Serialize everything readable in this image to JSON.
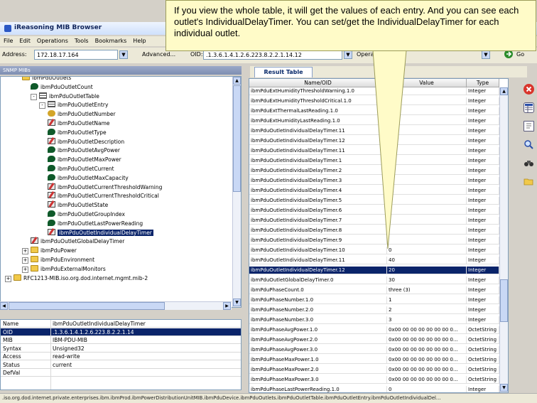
{
  "app": {
    "title": "iReasoning MIB Browser"
  },
  "menu": [
    "File",
    "Edit",
    "Operations",
    "Tools",
    "Bookmarks",
    "Help"
  ],
  "address_bar": {
    "address_label": "Address:",
    "address_value": "172.18.17.164",
    "advanced_label": "Advanced...",
    "oid_label": "OID:",
    "oid_value": ".1.3.6.1.4.1.2.6.223.8.2.2.1.14.12",
    "operations_label": "Opera",
    "go_label": "Go"
  },
  "left_panel": {
    "title": "SNMP MIBs"
  },
  "tree": [
    {
      "label": "ibmPduOutlets",
      "icon": "folder-icon",
      "indent": 2,
      "expander": ""
    },
    {
      "label": "ibmPduOutletCount",
      "icon": "leaf-icon",
      "indent": 3,
      "expander": ""
    },
    {
      "label": "ibmPduOutletTable",
      "icon": "table-icon",
      "indent": 3,
      "expander": "-"
    },
    {
      "label": "ibmPduOutletEntry",
      "icon": "table-icon",
      "indent": 4,
      "expander": "-"
    },
    {
      "label": "ibmPduOutletNumber",
      "icon": "key-icon",
      "indent": 5,
      "expander": ""
    },
    {
      "label": "ibmPduOutletName",
      "icon": "write-icon",
      "indent": 5,
      "expander": ""
    },
    {
      "label": "ibmPduOutletType",
      "icon": "leaf-icon",
      "indent": 5,
      "expander": ""
    },
    {
      "label": "ibmPduOutletDescription",
      "icon": "write-icon",
      "indent": 5,
      "expander": ""
    },
    {
      "label": "ibmPduOutletAvgPower",
      "icon": "leaf-icon",
      "indent": 5,
      "expander": ""
    },
    {
      "label": "ibmPduOutletMaxPower",
      "icon": "leaf-icon",
      "indent": 5,
      "expander": ""
    },
    {
      "label": "ibmPduOutletCurrent",
      "icon": "leaf-icon",
      "indent": 5,
      "expander": ""
    },
    {
      "label": "ibmPduOutletMaxCapacity",
      "icon": "leaf-icon",
      "indent": 5,
      "expander": ""
    },
    {
      "label": "ibmPduOutletCurrentThresholdWarning",
      "icon": "write-icon",
      "indent": 5,
      "expander": ""
    },
    {
      "label": "ibmPduOutletCurrentThresholdCritical",
      "icon": "write-icon",
      "indent": 5,
      "expander": ""
    },
    {
      "label": "ibmPduOutletState",
      "icon": "write-icon",
      "indent": 5,
      "expander": ""
    },
    {
      "label": "ibmPduOutletGroupIndex",
      "icon": "leaf-icon",
      "indent": 5,
      "expander": ""
    },
    {
      "label": "ibmPduOutletLastPowerReading",
      "icon": "leaf-icon",
      "indent": 5,
      "expander": ""
    },
    {
      "label": "ibmPduOutletIndividualDelayTimer",
      "icon": "write-icon",
      "indent": 5,
      "expander": "",
      "selected": true
    },
    {
      "label": "ibmPduOutletGlobalDelayTimer",
      "icon": "write-icon",
      "indent": 3,
      "expander": ""
    },
    {
      "label": "ibmPduPower",
      "icon": "folder-icon",
      "indent": 2,
      "expander": "+"
    },
    {
      "label": "ibmPduEnvironment",
      "icon": "folder-icon",
      "indent": 2,
      "expander": "+"
    },
    {
      "label": "ibmPduExternalMonitors",
      "icon": "folder-icon",
      "indent": 2,
      "expander": "+"
    },
    {
      "label": "RFC1213-MIB.iso.org.dod.internet.mgmt.mib-2",
      "icon": "folder-icon",
      "indent": 0,
      "expander": "+"
    }
  ],
  "properties": [
    {
      "key": "Name",
      "value": "ibmPduOutletIndividualDelayTimer"
    },
    {
      "key": "OID",
      "value": ".1.3.6.1.4.1.2.6.223.8.2.2.1.14",
      "selected": true
    },
    {
      "key": "MIB",
      "value": "IBM-PDU-MIB"
    },
    {
      "key": "Syntax",
      "value": "Unsigned32"
    },
    {
      "key": "Access",
      "value": "read-write"
    },
    {
      "key": "Status",
      "value": "current"
    },
    {
      "key": "DefVal",
      "value": ""
    }
  ],
  "result": {
    "tab_label": "Result Table",
    "columns": [
      "Name/OID",
      "Value",
      "Type"
    ],
    "rows": [
      [
        "ibmPduExtHumidityThresholdWarning.1.0",
        "",
        "Integer"
      ],
      [
        "ibmPduExtHumidityThresholdCritical.1.0",
        "",
        "Integer"
      ],
      [
        "ibmPduExtThermalLastReading.1.0",
        "",
        "Integer"
      ],
      [
        "ibmPduExtHumidityLastReading.1.0",
        "",
        "Integer"
      ],
      [
        "ibmPduOutletIndividualDelayTimer.11",
        "",
        "Integer"
      ],
      [
        "ibmPduOutletIndividualDelayTimer.12",
        "",
        "Integer"
      ],
      [
        "ibmPduOutletIndividualDelayTimer.11",
        "",
        "Integer"
      ],
      [
        "ibmPduOutletIndividualDelayTimer.1",
        "",
        "Integer"
      ],
      [
        "ibmPduOutletIndividualDelayTimer.2",
        "",
        "Integer"
      ],
      [
        "ibmPduOutletIndividualDelayTimer.3",
        "",
        "Integer"
      ],
      [
        "ibmPduOutletIndividualDelayTimer.4",
        "",
        "Integer"
      ],
      [
        "ibmPduOutletIndividualDelayTimer.5",
        "",
        "Integer"
      ],
      [
        "ibmPduOutletIndividualDelayTimer.6",
        "",
        "Integer"
      ],
      [
        "ibmPduOutletIndividualDelayTimer.7",
        "",
        "Integer"
      ],
      [
        "ibmPduOutletIndividualDelayTimer.8",
        "",
        "Integer"
      ],
      [
        "ibmPduOutletIndividualDelayTimer.9",
        "",
        "Integer"
      ],
      [
        "ibmPduOutletIndividualDelayTimer.10",
        "0",
        "Integer"
      ],
      [
        "ibmPduOutletIndividualDelayTimer.11",
        "40",
        "Integer"
      ],
      [
        "ibmPduOutletIndividualDelayTimer.12",
        "20",
        "Integer"
      ],
      [
        "ibmPduOutletGlobalDelayTimer.0",
        "30",
        "Integer"
      ],
      [
        "ibmPduPhaseCount.0",
        "three (3)",
        "Integer"
      ],
      [
        "ibmPduPhaseNumber.1.0",
        "1",
        "Integer"
      ],
      [
        "ibmPduPhaseNumber.2.0",
        "2",
        "Integer"
      ],
      [
        "ibmPduPhaseNumber.3.0",
        "3",
        "Integer"
      ],
      [
        "ibmPduPhaseAvgPower.1.0",
        "0x00 00 00 00 00 00 00 0...",
        "OctetString"
      ],
      [
        "ibmPduPhaseAvgPower.2.0",
        "0x00 00 00 00 00 00 00 0...",
        "OctetString"
      ],
      [
        "ibmPduPhaseAvgPower.3.0",
        "0x00 00 00 00 00 00 00 0...",
        "OctetString"
      ],
      [
        "ibmPduPhaseMaxPower.1.0",
        "0x00 00 00 00 00 00 00 0...",
        "OctetString"
      ],
      [
        "ibmPduPhaseMaxPower.2.0",
        "0x00 00 00 00 00 00 00 0...",
        "OctetString"
      ],
      [
        "ibmPduPhaseMaxPower.3.0",
        "0x00 00 00 00 00 00 00 0...",
        "OctetString"
      ],
      [
        "ibmPduPhaseLastPowerReading.1.0",
        "0",
        "Integer"
      ]
    ],
    "selected_row": 18
  },
  "status_bar": ".iso.org.dod.internet.private.enterprises.ibm.ibmProd.ibmPowerDistributionUnitMIB.ibmPduDevice.ibmPduOutlets.ibmPduOutletTable.ibmPduOutletEntry.ibmPduOutletIndividualDel...",
  "callout": {
    "text": "If you view the whole table, it will get the values of each entry. And you can see each outlet's IndividualDelayTimer. You can set/get the IndividualDelayTimer for each individual outlet."
  },
  "colors": {
    "selection": "#0a246a",
    "callout_bg": "#fffbc8",
    "folder": "#f1c94a",
    "leaf": "#0f5a2a"
  }
}
